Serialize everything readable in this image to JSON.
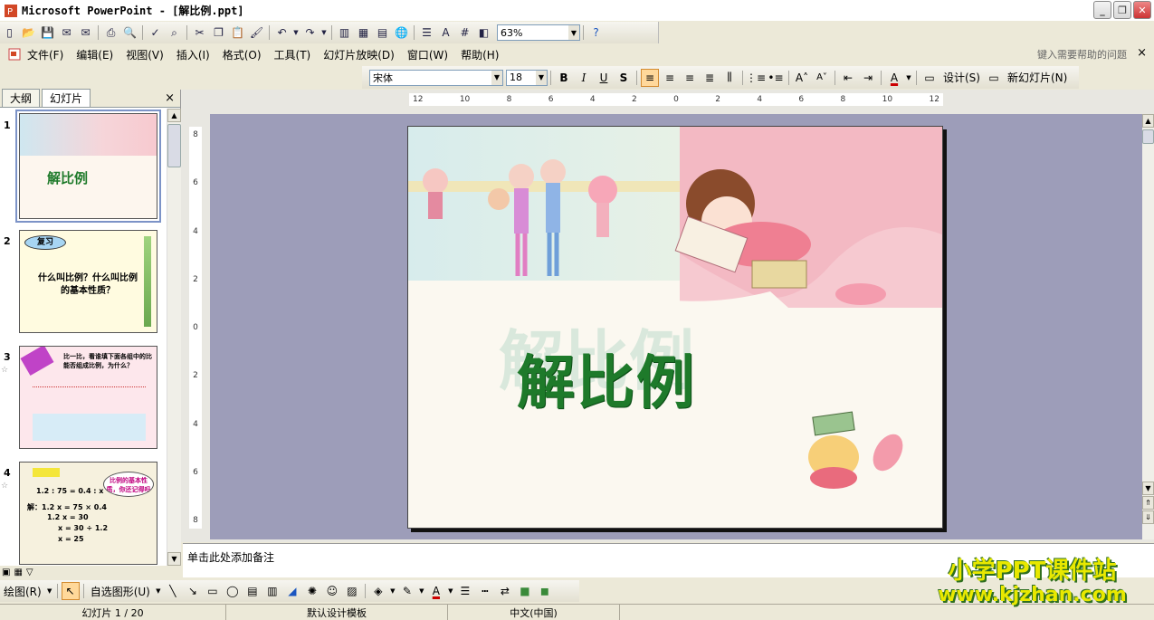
{
  "window": {
    "title": "Microsoft PowerPoint - [解比例.ppt]",
    "buttons": [
      "_",
      "❐",
      "✕"
    ]
  },
  "standard_toolbar": {
    "zoom": "63%"
  },
  "menubar": {
    "items": [
      "文件(F)",
      "编辑(E)",
      "视图(V)",
      "插入(I)",
      "格式(O)",
      "工具(T)",
      "幻灯片放映(D)",
      "窗口(W)",
      "帮助(H)"
    ],
    "help_placeholder": "键入需要帮助的问题"
  },
  "format_toolbar": {
    "font": "宋体",
    "size": "18",
    "bold": "B",
    "italic": "I",
    "underline": "U",
    "shadow": "S",
    "design_label": "设计(S)",
    "new_slide_label": "新幻灯片(N)"
  },
  "left_pane": {
    "tabs": [
      "大纲",
      "幻灯片"
    ],
    "thumbnails": [
      {
        "num": "1",
        "text": "解比例"
      },
      {
        "num": "2",
        "bubble": "复习",
        "text": "什么叫比例？什么叫比例的基本性质？"
      },
      {
        "num": "3",
        "text": "比一比，看谁填下面各组中的比能否组成比例，为什么？"
      },
      {
        "num": "4",
        "bubble": "比例的基本性质，你还记得吗",
        "eq1": "1.2 : 75 = 0.4 : x",
        "eq2": "解：1.2 x = 75 × 0.4",
        "eq3": "1.2 x = 30",
        "eq4": "x = 30 ÷ 1.2",
        "eq5": "x = 25"
      }
    ]
  },
  "ruler": {
    "h_ticks": [
      "12",
      "10",
      "8",
      "6",
      "4",
      "2",
      "0",
      "2",
      "4",
      "6",
      "8",
      "10",
      "12"
    ],
    "v_ticks": [
      "8",
      "6",
      "4",
      "2",
      "0",
      "2",
      "4",
      "6",
      "8"
    ]
  },
  "slide": {
    "title": "解比例"
  },
  "notes": {
    "placeholder": "单击此处添加备注"
  },
  "drawing_toolbar": {
    "draw_label": "绘图(R)",
    "autoshapes_label": "自选图形(U)"
  },
  "status": {
    "slide_pos": "幻灯片 1 / 20",
    "template": "默认设计模板",
    "language": "中文(中国)"
  },
  "watermark": {
    "line1": "小学PPT课件站",
    "line2": "www.kjzhan.com"
  },
  "colors": {
    "title_green": "#1e7a2a",
    "workspace": "#9d9db9"
  }
}
